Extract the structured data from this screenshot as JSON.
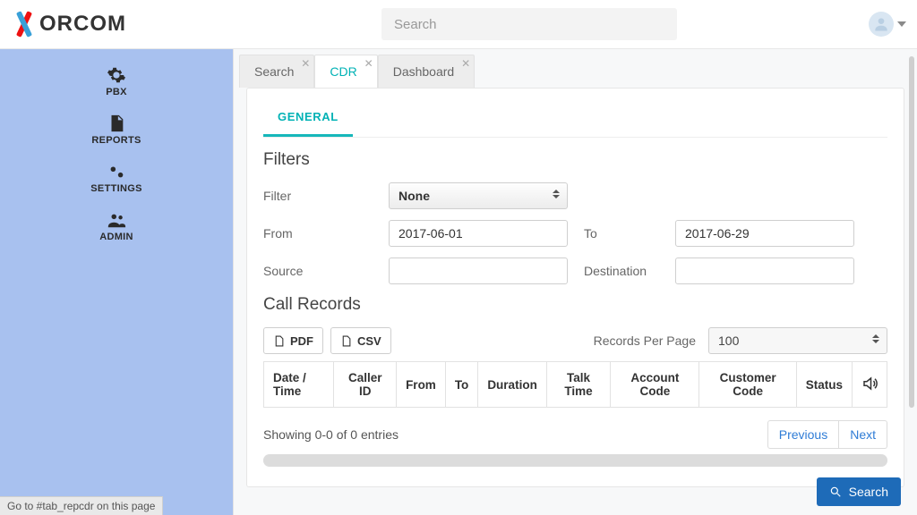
{
  "brand": {
    "name": "ORCOM"
  },
  "search": {
    "placeholder": "Search"
  },
  "sidebar": {
    "items": [
      {
        "label": "PBX"
      },
      {
        "label": "REPORTS"
      },
      {
        "label": "SETTINGS"
      },
      {
        "label": "ADMIN"
      }
    ]
  },
  "tabs": [
    {
      "label": "Search",
      "closable": true,
      "active": false
    },
    {
      "label": "CDR",
      "closable": true,
      "active": true
    },
    {
      "label": "Dashboard",
      "closable": true,
      "active": false
    }
  ],
  "subtabs": [
    {
      "label": "GENERAL",
      "active": true
    }
  ],
  "sections": {
    "filters_title": "Filters",
    "records_title": "Call Records"
  },
  "filters": {
    "filter_label": "Filter",
    "filter_value": "None",
    "from_label": "From",
    "from_value": "2017-06-01",
    "to_label": "To",
    "to_value": "2017-06-29",
    "source_label": "Source",
    "source_value": "",
    "dest_label": "Destination",
    "dest_value": ""
  },
  "export": {
    "pdf_label": "PDF",
    "csv_label": "CSV"
  },
  "records": {
    "rpp_label": "Records Per Page",
    "rpp_value": "100",
    "columns": [
      "Date / Time",
      "Caller ID",
      "From",
      "To",
      "Duration",
      "Talk Time",
      "Account Code",
      "Customer Code",
      "Status"
    ],
    "showing": "Showing 0-0 of 0 entries",
    "prev": "Previous",
    "next": "Next"
  },
  "fab": {
    "label": "Search"
  },
  "statusbar": {
    "text": "Go to #tab_repcdr on this page"
  }
}
